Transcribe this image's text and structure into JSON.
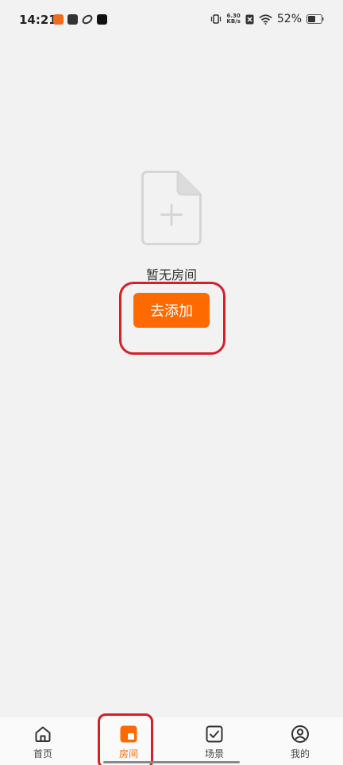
{
  "status_bar": {
    "time": "14:21",
    "net_speed_value": "6.30",
    "net_speed_unit": "KB/s",
    "battery_percent": "52%"
  },
  "empty_state": {
    "message": "暂无房间",
    "add_button_label": "去添加"
  },
  "bottom_nav": {
    "items": [
      {
        "label": "首页",
        "icon": "home-icon"
      },
      {
        "label": "房间",
        "icon": "room-icon",
        "active": true
      },
      {
        "label": "场景",
        "icon": "scene-check-icon"
      },
      {
        "label": "我的",
        "icon": "profile-icon"
      }
    ]
  },
  "colors": {
    "accent": "#ff6a00",
    "background": "#f2f2f2",
    "highlight": "#d4202a"
  }
}
